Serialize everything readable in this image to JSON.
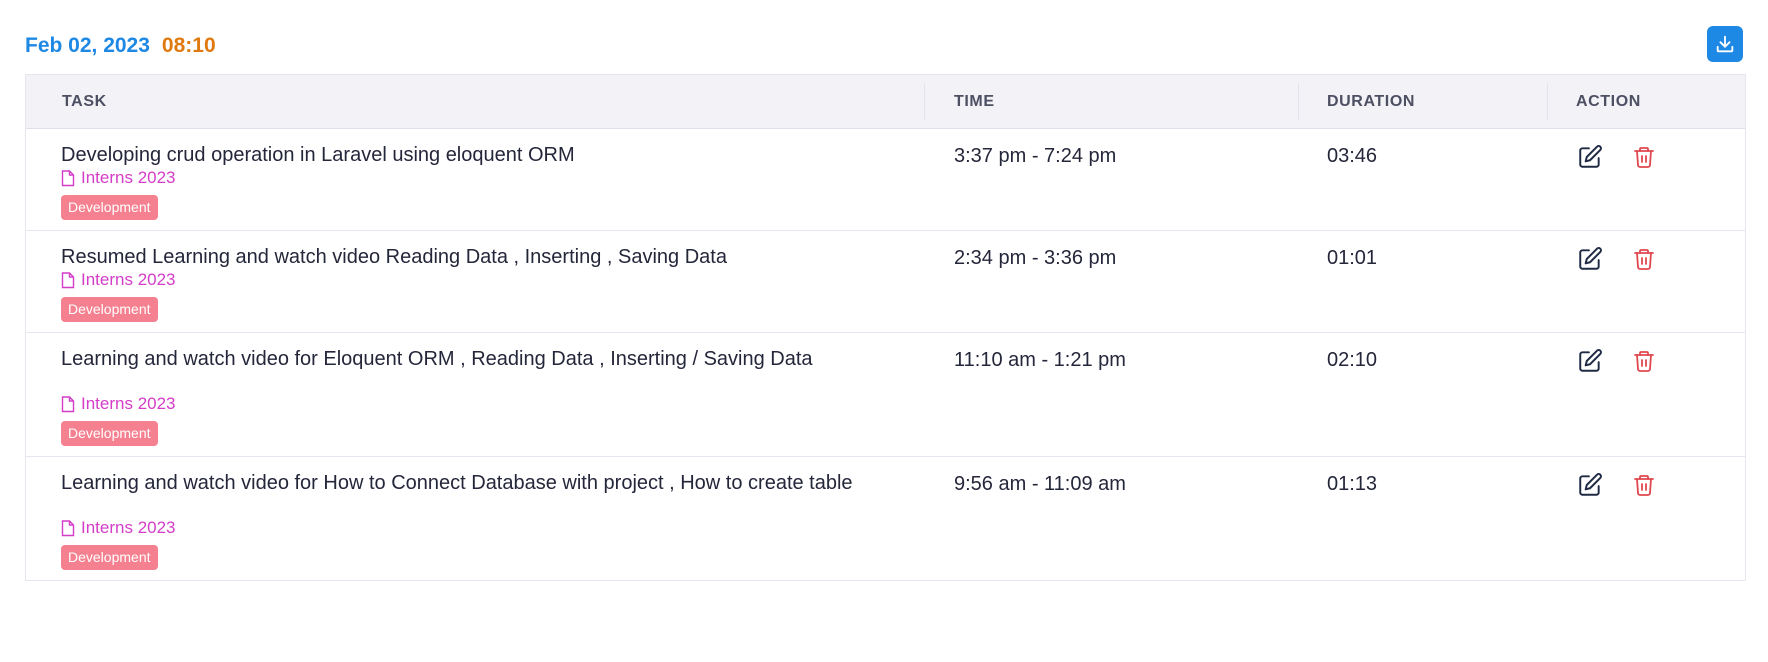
{
  "header": {
    "date": "Feb 02, 2023",
    "total_time": "08:10"
  },
  "toolbar": {
    "download_icon": "download-icon"
  },
  "table": {
    "columns": [
      "TASK",
      "TIME",
      "DURATION",
      "ACTION"
    ],
    "rows": [
      {
        "title": "Developing crud operation in Laravel using eloquent ORM",
        "project": "Interns 2023",
        "tag": "Development",
        "time": "3:37 pm - 7:24 pm",
        "duration": "03:46"
      },
      {
        "title": "Resumed Learning and watch video Reading Data , Inserting , Saving Data",
        "project": "Interns 2023",
        "tag": "Development",
        "time": "2:34 pm - 3:36 pm",
        "duration": "01:01"
      },
      {
        "title": "Learning and watch video for Eloquent ORM , Reading Data , Inserting / Saving Data",
        "project": "Interns 2023",
        "tag": "Development",
        "time": "11:10 am - 1:21 pm",
        "duration": "02:10"
      },
      {
        "title": "Learning and watch video for How to Connect Database with project , How to create table",
        "project": "Interns 2023",
        "tag": "Development",
        "time": "9:56 am - 11:09 am",
        "duration": "01:13"
      }
    ]
  },
  "colors": {
    "date": "#1e88e5",
    "total_time": "#e07a10",
    "project": "#d43dc8",
    "tag_bg": "#f5808f",
    "delete": "#e0474f",
    "edit": "#1f2a44"
  }
}
